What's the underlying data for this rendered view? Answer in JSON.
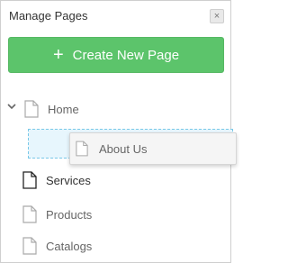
{
  "panel": {
    "title": "Manage Pages",
    "close_label": "×"
  },
  "create_button": {
    "icon": "plus-icon",
    "label": "Create New Page"
  },
  "tree": {
    "root": {
      "label": "Home",
      "expanded": true
    },
    "dragging_item": {
      "label": "About Us"
    },
    "items": [
      {
        "label": "Services",
        "active": true
      },
      {
        "label": "Products",
        "active": false
      },
      {
        "label": "Catalogs",
        "active": false
      }
    ]
  },
  "colors": {
    "create_button_bg": "#5cc46b",
    "drop_placeholder_bg": "#e7f6fd",
    "drop_placeholder_border": "#79c8e8"
  }
}
